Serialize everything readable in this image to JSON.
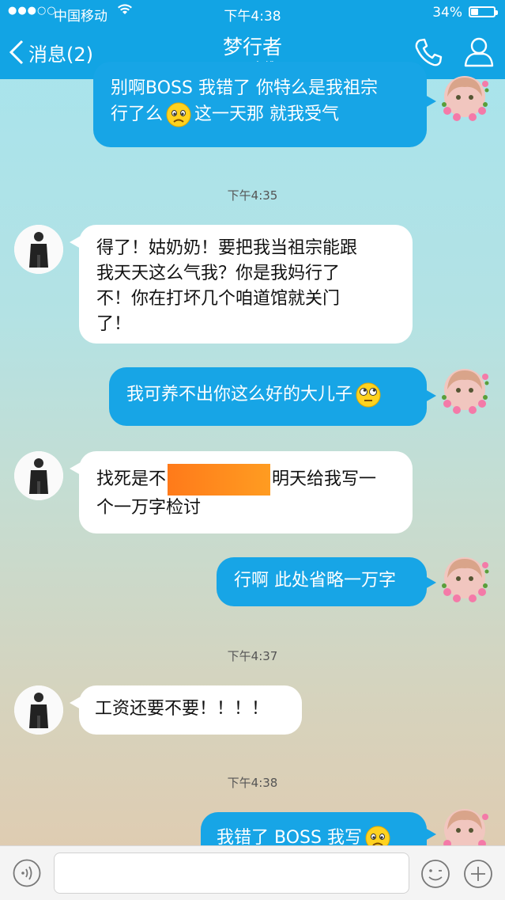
{
  "status_bar": {
    "signal": "●●●○○",
    "carrier": "中国移动",
    "time": "下午4:38",
    "battery_text": "34%",
    "battery_level": 0.34
  },
  "nav": {
    "back_label": "消息(2)",
    "contact_name": "梦行者",
    "contact_status": "iPad在线"
  },
  "messages": [
    {
      "side": "out",
      "lines": [
        "别啊BOSS 我错了 你特么是我祖宗",
        "行了么",
        "这一天那 就我受气"
      ],
      "emoji": "sad-face-icon"
    },
    {
      "timestamp": "下午4:35"
    },
    {
      "side": "in",
      "lines": [
        "得了！姑奶奶！要把我当祖宗能跟",
        "我天天这么气我？你是我妈行了",
        "不！你在打坏几个咱道馆就关门",
        "了！"
      ]
    },
    {
      "side": "out",
      "text": "我可养不出你这么好的大儿子",
      "emoji": "rolling-eyes-icon"
    },
    {
      "side": "in",
      "before": "找死是不",
      "after": "明天给我写一",
      "line2": "个一万字检讨"
    },
    {
      "side": "out",
      "text": "行啊 此处省略一万字"
    },
    {
      "timestamp": "下午4:37"
    },
    {
      "side": "in",
      "text": "工资还要不要！！！！"
    },
    {
      "timestamp": "下午4:38"
    },
    {
      "side": "out",
      "text": "我错了 BOSS 我写",
      "emoji": "sad-face-icon"
    }
  ],
  "input": {
    "placeholder": ""
  }
}
